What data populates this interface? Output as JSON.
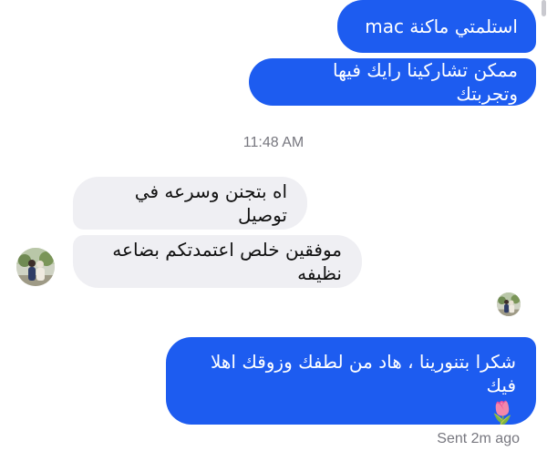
{
  "messages": {
    "m1": "استلمتي ماكنة mac",
    "m2": "ممكن تشاركينا رايك فيها وتجربتك",
    "timestamp": "11:48 AM",
    "m3": "اه بتجنن وسرعه في توصيل",
    "m4": "موفقين خلص اعتمدتكم  بضاعه نظيفه",
    "m5": "شكرا بتنورينا ، هاد من لطفك وزوقك اهلا فيك",
    "m5_emoji": "🌷"
  },
  "status": {
    "sent": "Sent 2m ago"
  },
  "colors": {
    "outgoing_bubble": "#1d5cf0",
    "incoming_bubble": "#efeff3",
    "meta_text": "#77777f"
  }
}
